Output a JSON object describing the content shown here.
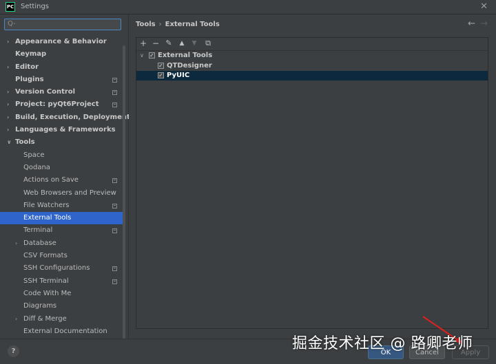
{
  "window": {
    "title": "Settings",
    "app_icon": "PC"
  },
  "sidebar": {
    "search_placeholder": "Q-",
    "items": [
      {
        "label": "Appearance & Behavior",
        "level": 0,
        "expand": "collapsed",
        "bold": true,
        "mod": false
      },
      {
        "label": "Keymap",
        "level": 0,
        "expand": "none",
        "bold": true,
        "mod": false
      },
      {
        "label": "Editor",
        "level": 0,
        "expand": "collapsed",
        "bold": true,
        "mod": false
      },
      {
        "label": "Plugins",
        "level": 0,
        "expand": "none",
        "bold": true,
        "mod": true
      },
      {
        "label": "Version Control",
        "level": 0,
        "expand": "collapsed",
        "bold": true,
        "mod": true
      },
      {
        "label": "Project: pyQt6Project",
        "level": 0,
        "expand": "collapsed",
        "bold": true,
        "mod": true
      },
      {
        "label": "Build, Execution, Deployment",
        "level": 0,
        "expand": "collapsed",
        "bold": true,
        "mod": false
      },
      {
        "label": "Languages & Frameworks",
        "level": 0,
        "expand": "collapsed",
        "bold": true,
        "mod": false
      },
      {
        "label": "Tools",
        "level": 0,
        "expand": "expanded",
        "bold": true,
        "mod": false
      },
      {
        "label": "Space",
        "level": 1,
        "expand": "none",
        "bold": false,
        "mod": false
      },
      {
        "label": "Qodana",
        "level": 1,
        "expand": "none",
        "bold": false,
        "mod": false
      },
      {
        "label": "Actions on Save",
        "level": 1,
        "expand": "none",
        "bold": false,
        "mod": true
      },
      {
        "label": "Web Browsers and Preview",
        "level": 1,
        "expand": "none",
        "bold": false,
        "mod": false
      },
      {
        "label": "File Watchers",
        "level": 1,
        "expand": "none",
        "bold": false,
        "mod": true
      },
      {
        "label": "External Tools",
        "level": 1,
        "expand": "none",
        "bold": false,
        "mod": false,
        "selected": true
      },
      {
        "label": "Terminal",
        "level": 1,
        "expand": "none",
        "bold": false,
        "mod": true
      },
      {
        "label": "Database",
        "level": 1,
        "expand": "collapsed",
        "bold": false,
        "mod": false
      },
      {
        "label": "CSV Formats",
        "level": 1,
        "expand": "none",
        "bold": false,
        "mod": false
      },
      {
        "label": "SSH Configurations",
        "level": 1,
        "expand": "none",
        "bold": false,
        "mod": true
      },
      {
        "label": "SSH Terminal",
        "level": 1,
        "expand": "none",
        "bold": false,
        "mod": true
      },
      {
        "label": "Code With Me",
        "level": 1,
        "expand": "none",
        "bold": false,
        "mod": false
      },
      {
        "label": "Diagrams",
        "level": 1,
        "expand": "none",
        "bold": false,
        "mod": false
      },
      {
        "label": "Diff & Merge",
        "level": 1,
        "expand": "collapsed",
        "bold": false,
        "mod": false
      },
      {
        "label": "External Documentation",
        "level": 1,
        "expand": "none",
        "bold": false,
        "mod": false
      }
    ]
  },
  "main": {
    "breadcrumb_root": "Tools",
    "breadcrumb_sep": "›",
    "breadcrumb_current": "External Tools",
    "toolbar": {
      "add": "+",
      "remove": "−",
      "edit": "✎",
      "up": "▲",
      "down": "▼",
      "copy": "⧉"
    },
    "tools_tree": {
      "group": {
        "label": "External Tools",
        "checked": true
      },
      "items": [
        {
          "label": "QTDesigner",
          "checked": true,
          "selected": false
        },
        {
          "label": "PyUIC",
          "checked": true,
          "selected": true
        }
      ]
    }
  },
  "buttons": {
    "help": "?",
    "ok": "OK",
    "cancel": "Cancel",
    "apply": "Apply"
  },
  "watermark": "掘金技术社区 @ 路卿老师",
  "colors": {
    "selection": "#2f65ca",
    "ok_button": "#365880",
    "background": "#3c3f41"
  }
}
